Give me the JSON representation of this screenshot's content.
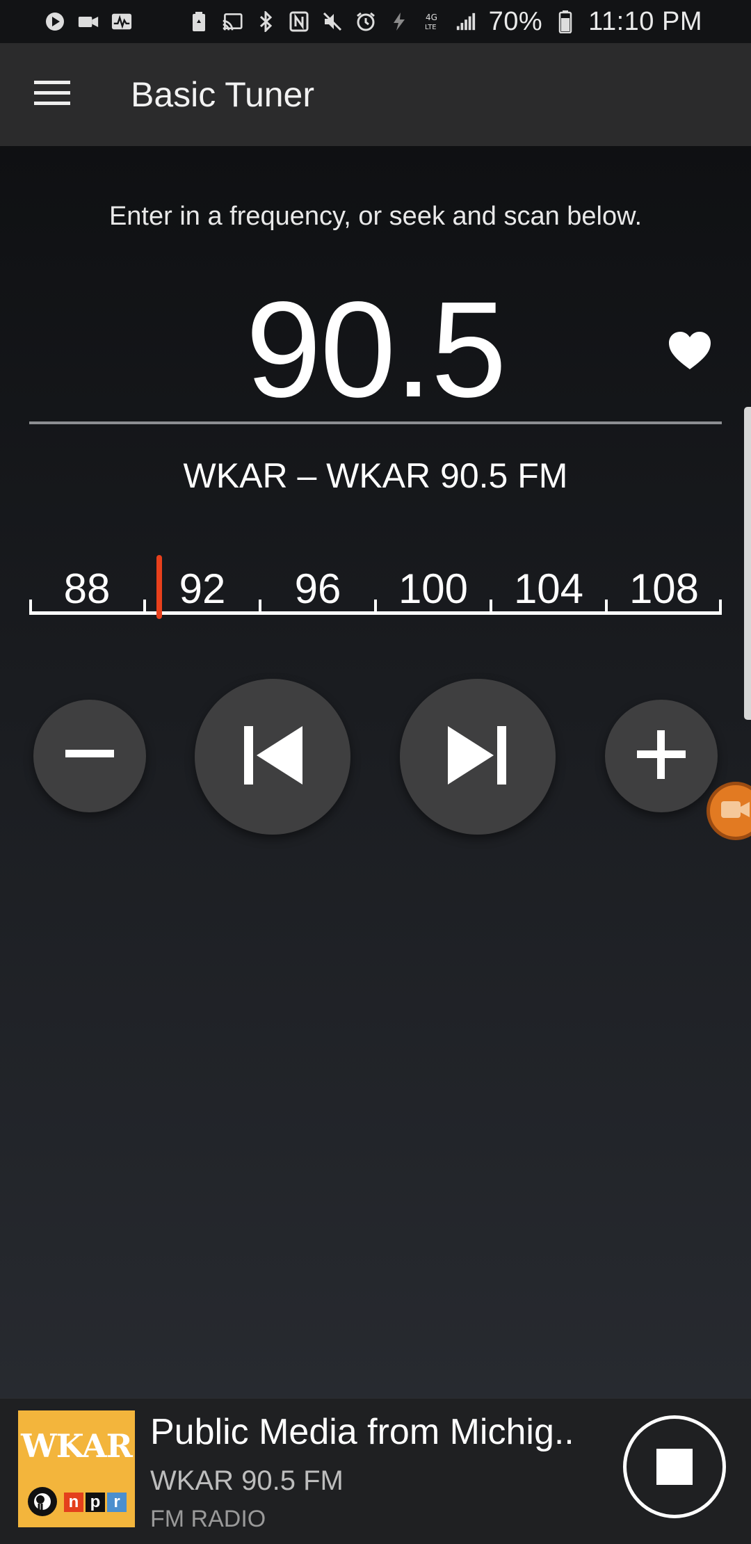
{
  "status_bar": {
    "left_icons": [
      "play-store-icon",
      "video-camera-icon",
      "activity-icon"
    ],
    "right_icons": [
      "battery-saver-icon",
      "cast-icon",
      "bluetooth-icon",
      "nfc-icon",
      "mute-icon",
      "alarm-icon",
      "flash-icon",
      "4g-lte-icon",
      "signal-icon"
    ],
    "battery": "70%",
    "time": "11:10 PM"
  },
  "app_bar": {
    "title": "Basic Tuner",
    "menu_icon": "hamburger-menu-icon"
  },
  "tuner": {
    "instructions": "Enter in a frequency, or seek and scan below.",
    "frequency": "90.5",
    "favorite_icon": "heart-icon",
    "station": "WKAR – WKAR 90.5 FM",
    "dial": {
      "labels": [
        "88",
        "92",
        "96",
        "100",
        "104",
        "108"
      ],
      "min": 88,
      "max": 108,
      "current": 90.5,
      "needle_color": "#e8401c"
    }
  },
  "controls": {
    "step_down_icon": "minus-icon",
    "seek_back_icon": "skip-previous-icon",
    "seek_forward_icon": "skip-next-icon",
    "step_up_icon": "plus-icon"
  },
  "now_playing": {
    "logo": {
      "text": "WKAR",
      "npr_letters": [
        "n",
        "p",
        "r"
      ],
      "npr_colors": [
        "#e4401c",
        "#111111",
        "#4b8fce"
      ],
      "bg_color": "#f3b53c"
    },
    "title": "Public Media from Michig..",
    "station": "WKAR 90.5 FM",
    "source": "FM RADIO",
    "stop_icon": "stop-icon"
  },
  "overlay": {
    "floating_icon": "video-camera-icon"
  }
}
